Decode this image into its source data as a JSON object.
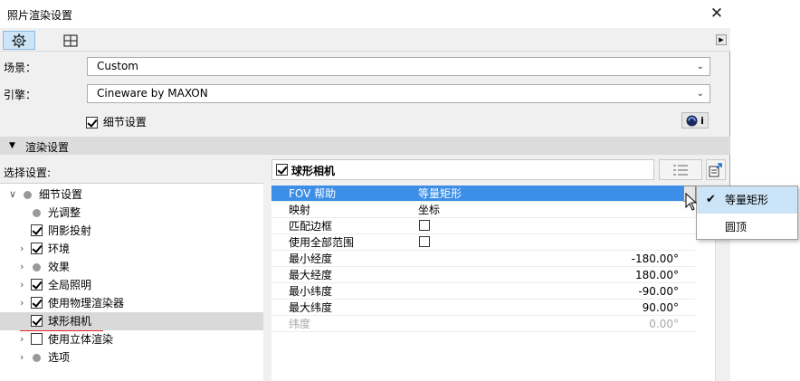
{
  "window": {
    "title": "照片渲染设置"
  },
  "toolbar": {
    "tab1_icon": "gear-icon",
    "tab2_icon": "grid-window-icon",
    "play_icon": "play-right-icon"
  },
  "scene": {
    "label": "场景：",
    "value": "Custom"
  },
  "engine": {
    "label": "引擎：",
    "value": "Cineware by MAXON"
  },
  "detail": {
    "label": "细节设置",
    "checked": true
  },
  "c4d": {
    "info": "i"
  },
  "section": {
    "title": "渲染设置"
  },
  "select": {
    "label": "选择设置:"
  },
  "tree": [
    {
      "label": "细节设置",
      "kind": "dot",
      "expand": "open"
    },
    {
      "label": "光调整",
      "kind": "dot",
      "expand": "none"
    },
    {
      "label": "阴影投射",
      "kind": "checkbox",
      "checked": true,
      "expand": "none"
    },
    {
      "label": "环境",
      "kind": "checkbox",
      "checked": true,
      "expand": "closed"
    },
    {
      "label": "效果",
      "kind": "dot",
      "expand": "closed"
    },
    {
      "label": "全局照明",
      "kind": "checkbox",
      "checked": true,
      "expand": "closed"
    },
    {
      "label": "使用物理渲染器",
      "kind": "checkbox",
      "checked": true,
      "expand": "closed"
    },
    {
      "label": "球形相机",
      "kind": "checkbox",
      "checked": true,
      "expand": "none",
      "selected": true
    },
    {
      "label": "使用立体渲染",
      "kind": "checkbox",
      "checked": false,
      "expand": "closed"
    },
    {
      "label": "选项",
      "kind": "dot",
      "expand": "closed"
    }
  ],
  "panel": {
    "title": "球形相机",
    "checked": true
  },
  "params": [
    {
      "name": "FOV 帮助",
      "value": "等量矩形",
      "highlight": true
    },
    {
      "name": "映射",
      "value": "坐标"
    },
    {
      "name": "匹配边框",
      "checkbox": true
    },
    {
      "name": "使用全部范围",
      "checkbox": true
    },
    {
      "name": "最小经度",
      "num": "-180.00°"
    },
    {
      "name": "最大经度",
      "num": "180.00°"
    },
    {
      "name": "最小纬度",
      "num": "-90.00°"
    },
    {
      "name": "最大纬度",
      "num": "90.00°"
    },
    {
      "name": "纬度",
      "num": "0.00°",
      "disabled": true
    }
  ],
  "dropdown": {
    "options": [
      {
        "label": "等量矩形",
        "selected": true
      },
      {
        "label": "圆顶",
        "selected": false
      }
    ]
  },
  "colors": {
    "highlight": "#3c8ee6",
    "redbox": "#e8262a",
    "selected_row": "#d9d9d9"
  }
}
